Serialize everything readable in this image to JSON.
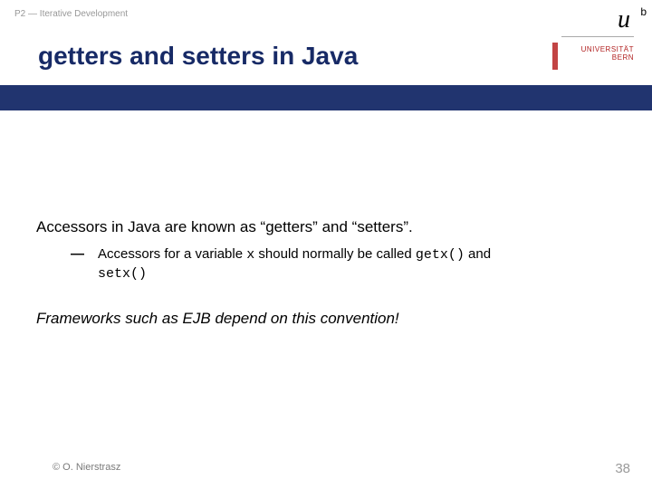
{
  "header": {
    "label": "P2 — Iterative Development"
  },
  "logo": {
    "u_html": "u",
    "sup": "b",
    "line1": "UNIVERSITÄT",
    "line2": "BERN"
  },
  "title": "getters and setters in Java",
  "content": {
    "intro": "Accessors in Java are known as “getters” and “setters”.",
    "bullet_prefix": "Accessors for a variable ",
    "bullet_var": "x",
    "bullet_mid": " should normally be called ",
    "bullet_getx": "getx()",
    "bullet_and": " and ",
    "bullet_setx": "setx()",
    "frameworks": "Frameworks such as EJB depend on this convention!"
  },
  "footer": {
    "copyright": "© O. Nierstrasz",
    "page": "38"
  }
}
